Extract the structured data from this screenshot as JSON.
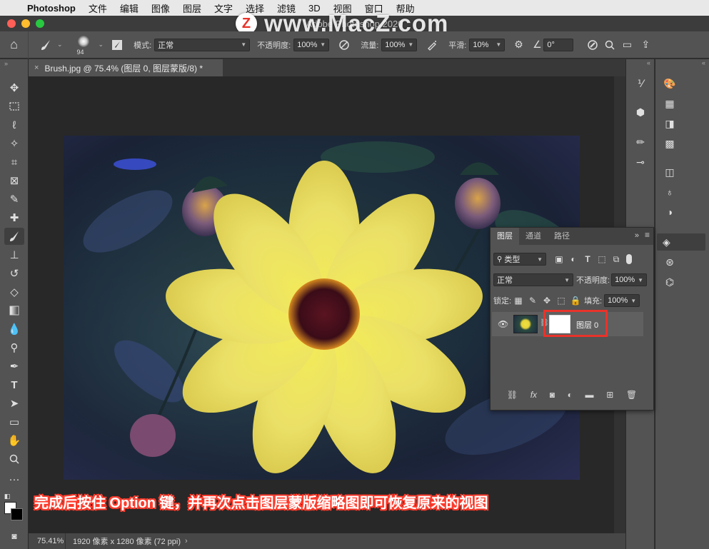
{
  "menubar": {
    "app_name": "Photoshop",
    "items": [
      "文件",
      "编辑",
      "图像",
      "图层",
      "文字",
      "选择",
      "滤镜",
      "3D",
      "视图",
      "窗口",
      "帮助"
    ]
  },
  "window": {
    "title": "Adobe Photoshop 2020"
  },
  "options_bar": {
    "brush_size": "94",
    "mode_label": "模式:",
    "mode_value": "正常",
    "opacity_label": "不透明度:",
    "opacity_value": "100%",
    "flow_label": "流量:",
    "flow_value": "100%",
    "smoothing_label": "平滑:",
    "smoothing_value": "10%",
    "angle_value": "0°"
  },
  "document_tab": {
    "title": "Brush.jpg @ 75.4% (图层 0, 图层蒙版/8) *",
    "close": "×"
  },
  "status_bar": {
    "zoom": "75.41%",
    "info": "1920 像素 x 1280 像素 (72 ppi)"
  },
  "layers_panel": {
    "tabs": [
      "图层",
      "通道",
      "路径"
    ],
    "filter_label": "类型",
    "blend_mode": "正常",
    "opacity_label": "不透明度:",
    "opacity_value": "100%",
    "lock_label": "锁定:",
    "fill_label": "填充:",
    "fill_value": "100%",
    "layer_name": "图层 0"
  },
  "caption": "完成后按住 Option 键，并再次点击图层蒙版缩略图即可恢复原来的视图",
  "watermark": "www.MacZ.com",
  "colors": {
    "highlight": "#e8332a",
    "panel": "#535353",
    "canvas": "#282828"
  }
}
